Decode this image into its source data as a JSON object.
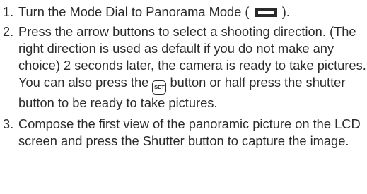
{
  "steps": [
    {
      "number": "1.",
      "text_before_icon": "Turn the Mode Dial to Panorama Mode (",
      "icon": "panorama-mode-icon",
      "text_after_icon": ")."
    },
    {
      "number": "2.",
      "text_before_icon": "Press the arrow buttons to select a shooting direction. (The right direction is used as default if you do not make any choice) 2 seconds later, the camera is ready to take pictures. You can also press the",
      "icon": "set-button-icon",
      "icon_text": "SET",
      "text_after_icon": "button or half press the shutter button to be ready to take pictures."
    },
    {
      "number": "3.",
      "text": "Compose the first view of the panoramic picture on the LCD screen and press the Shutter button to capture the image."
    }
  ]
}
